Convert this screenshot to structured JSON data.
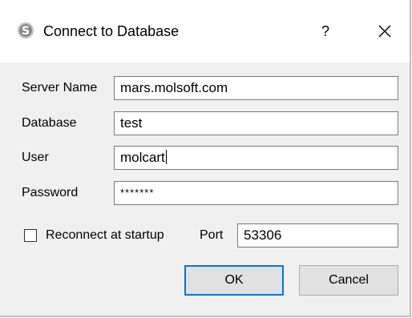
{
  "window": {
    "title": "Connect to Database",
    "help_label": "?",
    "app_icon": "molsoft-s-icon",
    "close_icon": "close-icon"
  },
  "form": {
    "server_name": {
      "label": "Server Name",
      "value": "mars.molsoft.com"
    },
    "database": {
      "label": "Database",
      "value": "test"
    },
    "user": {
      "label": "User",
      "value": "molcart"
    },
    "password": {
      "label": "Password",
      "value": "*******"
    },
    "reconnect": {
      "label": "Reconnect at startup",
      "checked": false
    },
    "port": {
      "label": "Port",
      "value": "53306"
    }
  },
  "buttons": {
    "ok_label": "OK",
    "cancel_label": "Cancel"
  },
  "colors": {
    "accent": "#0078d7",
    "dialog_bg": "#f0f0f0"
  }
}
